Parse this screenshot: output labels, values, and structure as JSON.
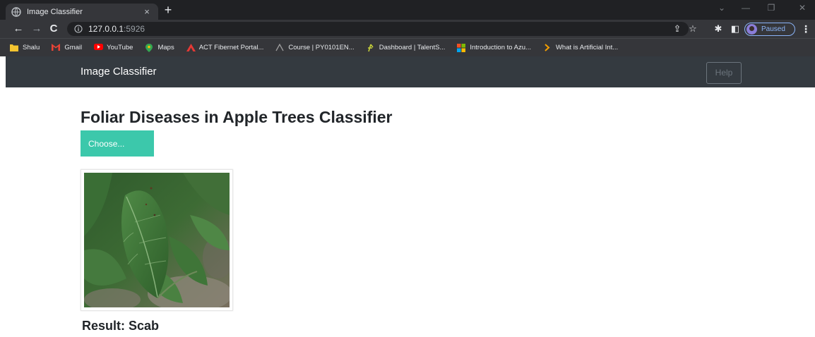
{
  "browser": {
    "tab_title": "Image Classifier",
    "tab_close": "×",
    "new_tab": "+",
    "url_host": "127.0.0.1",
    "url_port": ":5926",
    "profile_status": "Paused",
    "bookmarks": [
      {
        "label": "Shalu",
        "icon": "folder-icon",
        "color": "#f4c430"
      },
      {
        "label": "Gmail",
        "icon": "gmail-icon",
        "color": "#ea4335"
      },
      {
        "label": "YouTube",
        "icon": "youtube-icon",
        "color": "#ff0000"
      },
      {
        "label": "Maps",
        "icon": "maps-icon",
        "color": "#34a853"
      },
      {
        "label": "ACT Fibernet Portal...",
        "icon": "act-icon",
        "color": "#e53935"
      },
      {
        "label": "Course | PY0101EN...",
        "icon": "course-icon",
        "color": "#9e9e9e"
      },
      {
        "label": "Dashboard | TalentS...",
        "icon": "talent-icon",
        "color": "#c6d13a"
      },
      {
        "label": "Introduction to Azu...",
        "icon": "microsoft-icon",
        "color": "#00a4ef"
      },
      {
        "label": "What is Artificial Int...",
        "icon": "chevron-right-icon",
        "color": "#f59f00"
      }
    ]
  },
  "navbar": {
    "brand": "Image Classifier",
    "help_label": "Help"
  },
  "main": {
    "title": "Foliar Diseases in Apple Trees Classifier",
    "choose_label": "Choose...",
    "result_text": "Result: Scab",
    "image_alt": "leaf-photo"
  },
  "colors": {
    "accent": "#3cc8ab",
    "navbar_bg": "#343a40",
    "chrome_bg": "#35363a"
  }
}
